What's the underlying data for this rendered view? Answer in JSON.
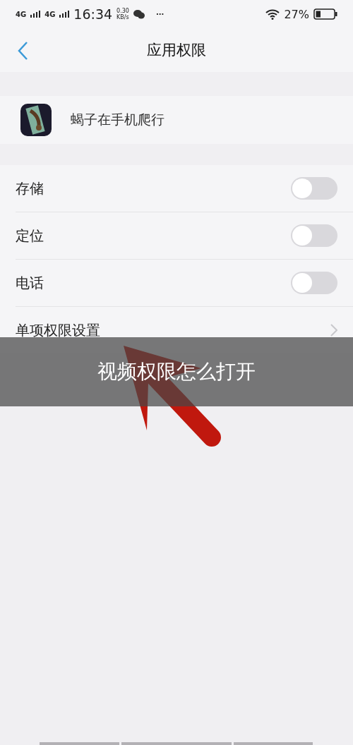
{
  "status_bar": {
    "network_1": "4G",
    "network_2": "4G",
    "time": "16:34",
    "speed_value": "0.30",
    "speed_unit": "KB/s",
    "more": "···",
    "battery": "27%",
    "battery_meter": {
      "level": 0.27
    }
  },
  "nav": {
    "title": "应用权限"
  },
  "app": {
    "name": "蝎子在手机爬行"
  },
  "permissions": [
    {
      "kind": "toggle",
      "label": "存储",
      "on": false
    },
    {
      "kind": "toggle",
      "label": "定位",
      "on": false
    },
    {
      "kind": "toggle",
      "label": "电话",
      "on": false
    },
    {
      "kind": "link",
      "label": "单项权限设置"
    }
  ],
  "caption": "视频权限怎么打开"
}
